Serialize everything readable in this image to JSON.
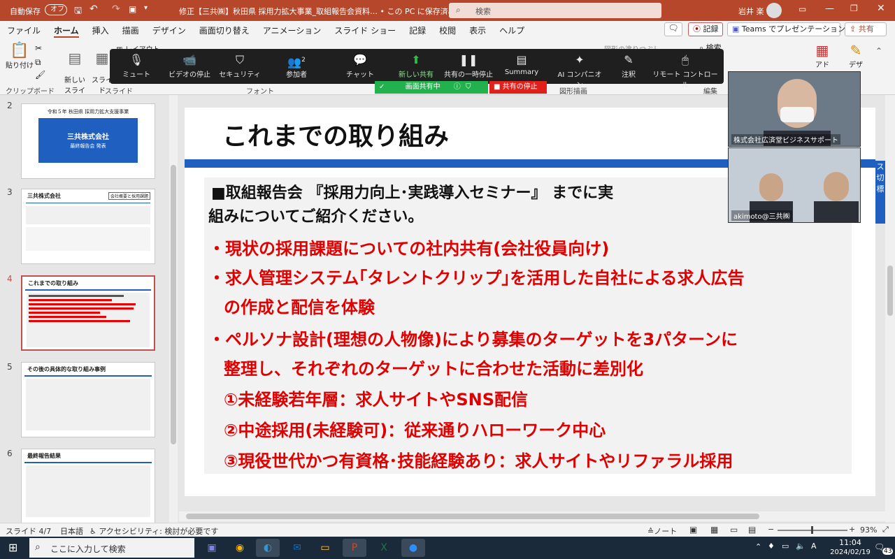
{
  "titlebar": {
    "autosave": "自動保存",
    "autosave_state": "オフ",
    "title": "修正【三共㈱】秋田県 採用力拡大事業_取組報告会資料… • この PC に保存済み",
    "search": "検索",
    "user": "岩井 楽"
  },
  "ribbon_tabs": [
    "ファイル",
    "ホーム",
    "挿入",
    "描画",
    "デザイン",
    "画面切り替え",
    "アニメーション",
    "スライド ショー",
    "記録",
    "校閲",
    "表示",
    "ヘルプ"
  ],
  "ribbon_right": {
    "comment": "",
    "record": "記録",
    "teams": "Teams でプレゼンテーション",
    "share": "共有"
  },
  "ribbon": {
    "paste": "貼り付け",
    "new_slide": "新しい\nスライド",
    "reuse": "スライド\n再利用",
    "layout": "レイアウト",
    "search": "検索",
    "groups": [
      "クリップボード",
      "スライド",
      "フォント",
      "図形描画",
      "編集"
    ],
    "shape_fill": "図形の塗りつぶし",
    "addin": "アド",
    "design": "デザ"
  },
  "zoom": {
    "buttons": [
      "ミュート",
      "ビデオの停止",
      "セキュリティ",
      "参加者",
      "チャット",
      "新しい共有",
      "共有の一時停止",
      "Summary",
      "AI コンパニオン",
      "注釈",
      "リモート コントロール"
    ],
    "participants_count": "2",
    "sharing": "画面共有中",
    "stop_share": "共有の停止"
  },
  "videos": [
    "株式会社広済堂ビジネスサポート",
    "akimoto@三共㈱"
  ],
  "thumbs": [
    {
      "num": "2",
      "title": "令和５年 秋田県 採用力拡大支援事業",
      "box1": "三共株式会社",
      "box2": "最終報告会 発表"
    },
    {
      "num": "3",
      "title": "三共株式会社",
      "tag": "会社概要と採用課題"
    },
    {
      "num": "4",
      "title": "これまでの取り組み"
    },
    {
      "num": "5",
      "title": "その後の具体的な取り組み事例"
    },
    {
      "num": "6",
      "title": "最終報告結果"
    }
  ],
  "slide": {
    "title": "これまでの取り組み",
    "lead": "■取組報告会 『採用力向上･実践導入セミナー』 までに実",
    "lead2": "組みについてご紹介ください。",
    "b1": "・現状の採用課題についての社内共有(会社役員向け)",
    "b2a": "・求人管理システム｢タレントクリップ｣を活用した自社による求人広告",
    "b2b": "の作成と配信を体験",
    "b3a": "・ペルソナ設計(理想の人物像)により募集のターゲットを3パターンに",
    "b3b": "整理し、それぞれのターゲットに合わせた活動に差別化",
    "s1": "①未経験若年層：求人サイトやSNS配信",
    "s2": "②中途採用(未経験可)：従来通りハローワーク中心",
    "s3": "③現役世代かつ有資格･技能経験あり：求人サイトやリファラル採用",
    "right_edge": "ス\n切\n標"
  },
  "status": {
    "slide": "スライド 4/7",
    "lang": "日本語",
    "accessibility": "アクセシビリティ: 検討が必要です",
    "notes": "ノート",
    "zoom": "93%"
  },
  "taskbar": {
    "search": "ここに入力して検索",
    "time": "11:04",
    "date": "2024/02/19",
    "notif": "43"
  },
  "colors": {
    "accent": "#b7472a",
    "red_text": "#e00000",
    "slide_bar": "#1f5fbf"
  }
}
